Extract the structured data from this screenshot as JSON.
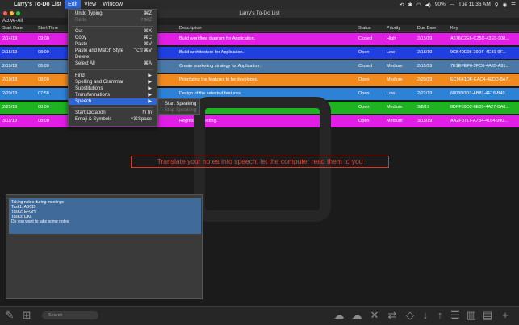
{
  "menubar": {
    "app_name": "Larry's To-Do List",
    "items": [
      "Edit",
      "View",
      "Window"
    ],
    "status": {
      "battery": "90%",
      "clock": "Tue 11:36 AM"
    }
  },
  "window": {
    "title": "Larry's To-Do List",
    "list_name": "Active-All"
  },
  "table": {
    "headers": {
      "start": "Start Date",
      "time": "Start Time",
      "desc": "Description",
      "status": "Status",
      "priority": "Priority",
      "due": "Due Date",
      "key": "Key"
    },
    "rows": [
      {
        "start": "2/14/19",
        "time": "09:00",
        "desc": "Build workflow diagram for Application.",
        "status": "Closed",
        "priority": "High",
        "due": "2/15/19",
        "key": "A676C2E6-C25D-43E9-908...",
        "color": "#e11ee6"
      },
      {
        "start": "2/15/19",
        "time": "08:00",
        "desc": "Build architecture for Application.",
        "status": "Open",
        "priority": "Low",
        "due": "2/18/19",
        "key": "9CB40E08-29DF-4E81-9F...",
        "color": "#1f3fe0"
      },
      {
        "start": "2/15/19",
        "time": "08:00",
        "desc": "Create marketing strategy for Application.",
        "status": "Closed",
        "priority": "Medium",
        "due": "2/15/19",
        "key": "7E1EFEF6-2FC6-4A65-A81...",
        "color": "#4a79a8"
      },
      {
        "start": "2/19/19",
        "time": "08:00",
        "desc": "Prioritizing the features to be developed.",
        "status": "Open",
        "priority": "Medium",
        "due": "2/20/19",
        "key": "EC9641DF-EAC4-4EDD-8A7...",
        "color": "#f08a1e"
      },
      {
        "start": "2/20/19",
        "time": "07:58",
        "desc": "Design of the selected features.",
        "status": "Open",
        "priority": "Low",
        "due": "2/22/19",
        "key": "6808D0D3-AB81-4F18-B49...",
        "color": "#2d82d8"
      },
      {
        "start": "2/25/19",
        "time": "08:00",
        "desc": "development of the features.",
        "status": "Open",
        "priority": "Medium",
        "due": "3/8/19",
        "key": "8DFF69D2-6E39-4A27-BA8...",
        "color": "#1fb324"
      },
      {
        "start": "3/11/19",
        "time": "08:00",
        "desc": "Regression testing.",
        "status": "Open",
        "priority": "Medium",
        "due": "3/15/19",
        "key": "AA2F0717-A7B4-4164-990...",
        "color": "#e11ee6"
      }
    ]
  },
  "caption": "Translate your notes into speech, let the computer read them to you",
  "notes": {
    "lines": [
      "Taking notes during meetings",
      "",
      "Task1: ABCD",
      "Task2: EFGH",
      "Task3: IJKL",
      "",
      "Do you want to take some notes"
    ]
  },
  "toolbar": {
    "search_placeholder": "Search"
  },
  "edit_menu": {
    "items": [
      {
        "label": "Undo Typing",
        "shortcut": "⌘Z"
      },
      {
        "label": "Redo",
        "shortcut": "⇧⌘Z"
      },
      {
        "label": "Cut",
        "shortcut": "⌘X"
      },
      {
        "label": "Copy",
        "shortcut": "⌘C"
      },
      {
        "label": "Paste",
        "shortcut": "⌘V"
      },
      {
        "label": "Paste and Match Style",
        "shortcut": "⌥⇧⌘V"
      },
      {
        "label": "Delete",
        "shortcut": ""
      },
      {
        "label": "Select All",
        "shortcut": "⌘A"
      },
      {
        "label": "Find",
        "shortcut": "▶"
      },
      {
        "label": "Spelling and Grammar",
        "shortcut": "▶"
      },
      {
        "label": "Substitutions",
        "shortcut": "▶"
      },
      {
        "label": "Transformations",
        "shortcut": "▶"
      },
      {
        "label": "Speech",
        "shortcut": "▶"
      },
      {
        "label": "Start Dictation",
        "shortcut": "fn fn"
      },
      {
        "label": "Emoji & Symbols",
        "shortcut": "^⌘Space"
      }
    ],
    "speech_submenu": [
      "Start Speaking",
      "Stop Speaking"
    ]
  }
}
